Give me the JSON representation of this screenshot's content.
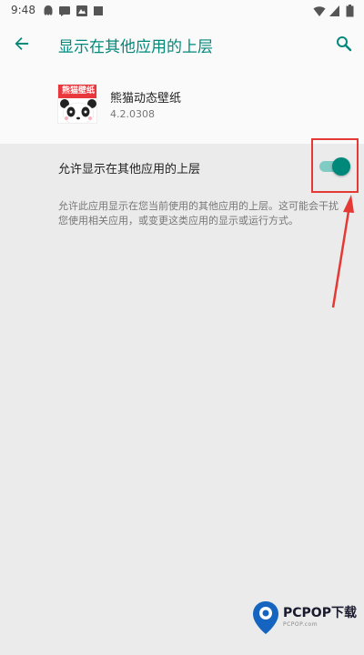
{
  "status_bar": {
    "time": "9:48",
    "left_icons": [
      "android-bug-icon",
      "chat-bubble-icon",
      "image-icon",
      "square-icon"
    ],
    "right_icons": [
      "wifi-icon",
      "cellular-signal-icon",
      "battery-icon"
    ]
  },
  "app_bar": {
    "title": "显示在其他应用的上层",
    "back_icon": "arrow-back-icon",
    "search_icon": "search-icon"
  },
  "app": {
    "icon_label": "熊猫壁纸",
    "name": "熊猫动态壁纸",
    "version": "4.2.0308"
  },
  "setting": {
    "label": "允许显示在其他应用的上层",
    "enabled": true,
    "summary": "允许此应用显示在您当前使用的其他应用的上层。这可能会干扰您使用相关应用，或变更这类应用的显示或运行方式。"
  },
  "annotation": {
    "highlight_color": "#e53935",
    "arrow_color": "#e53935"
  },
  "watermark": {
    "brand": "PCPOP下载",
    "url": "PCPOP.com"
  },
  "colors": {
    "accent": "#00897b",
    "switch_track": "#80cbc4",
    "panel_bg": "#ebebeb",
    "page_bg": "#fafafa"
  }
}
